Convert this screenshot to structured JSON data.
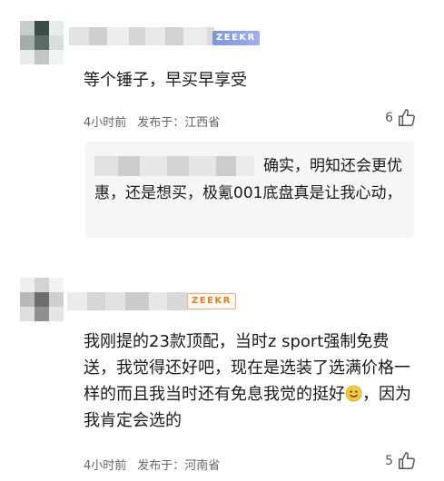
{
  "comments": [
    {
      "badge": "ZEEKR",
      "text": "等个锤子，早买早享受",
      "time": "4小时前",
      "location": "发布于：江西省",
      "likes": "6",
      "reply": {
        "text": "确实，明知还会更优惠，还是想买，极氪001底盘真是让我心动，"
      }
    },
    {
      "badge": "ZEEKR",
      "text_part1": "我刚提的23款顶配，当时z sport强制免费送，我觉得还好吧，现在是选装了选满价格一样的而且我当时还有免息我觉的挺好",
      "text_part2": "，因为我肯定会选的",
      "time": "4小时前",
      "location": "发布于：河南省",
      "likes": "5"
    }
  ],
  "colors": {
    "badge_blue": "#8fa2e2",
    "badge_orange": "#d7822b",
    "reply_background": "#f6f6f6",
    "meta_text": "#666666"
  },
  "icons": {
    "like": "thumbs-up-icon",
    "emoji": "smiling-face-emoji"
  }
}
